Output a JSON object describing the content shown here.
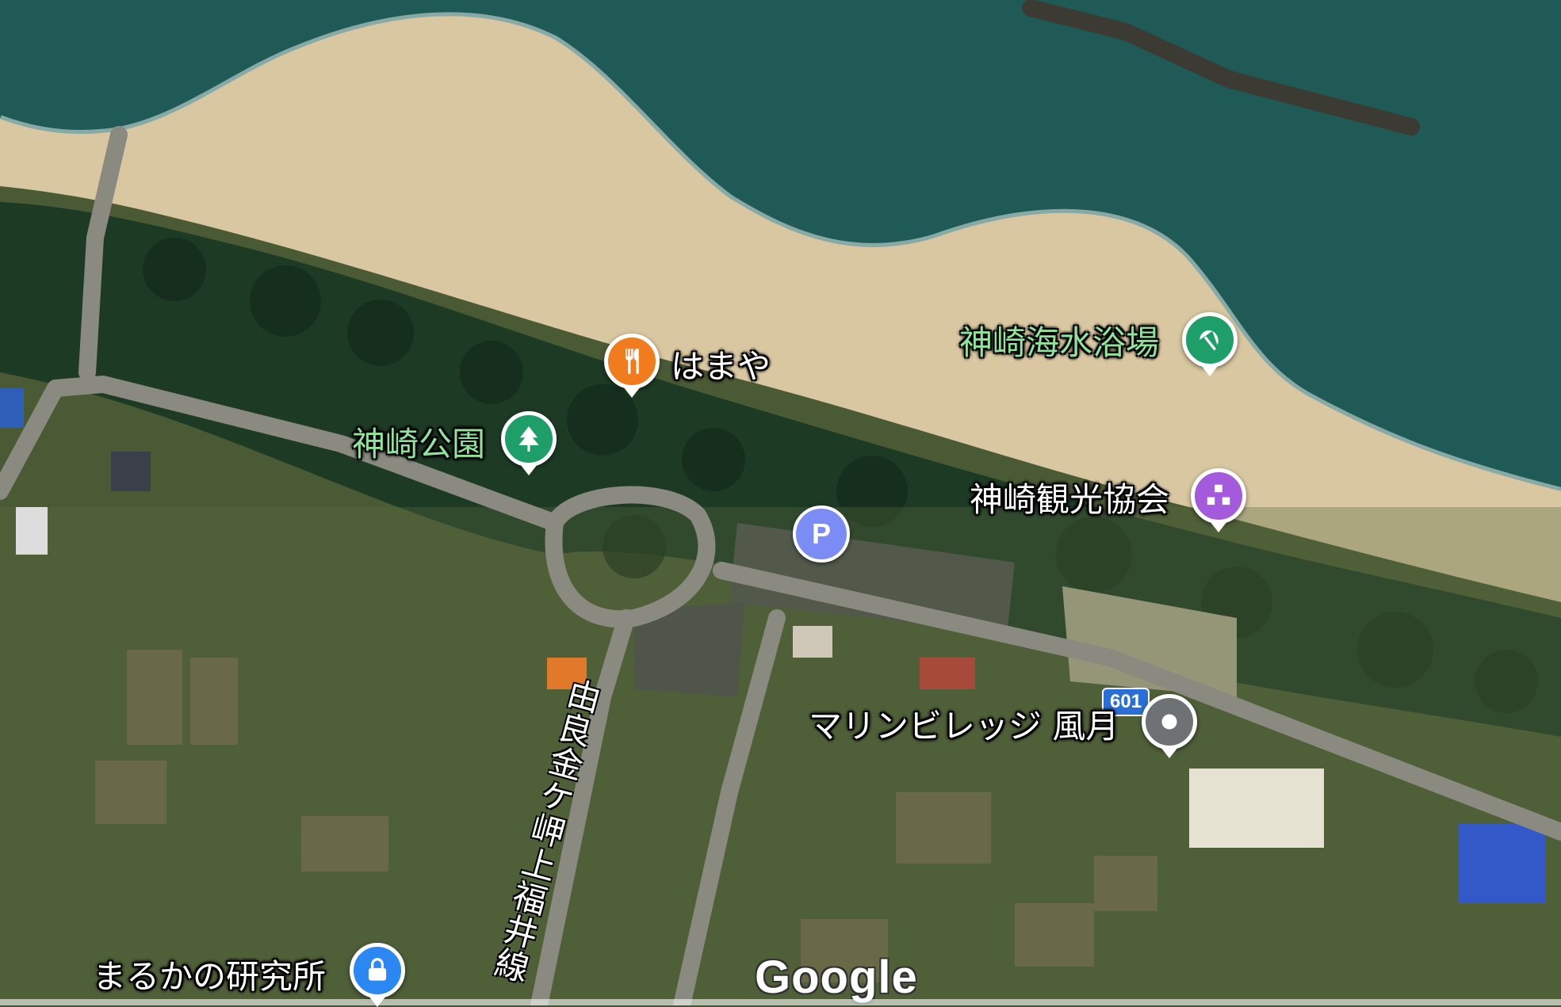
{
  "map": {
    "type": "satellite",
    "attribution_logo": "Google",
    "colors": {
      "sea": "#1f5a57",
      "sand": "#d8c7a0",
      "forest": "#1d3a25",
      "road": "#8a8a80",
      "fields": "#6f7a4c"
    }
  },
  "places": [
    {
      "id": "hamaya",
      "label": "はまや",
      "icon": "restaurant-icon",
      "color": "#f07c1e",
      "label_color": "white"
    },
    {
      "id": "kanzaki-beach",
      "label": "神崎海水浴場",
      "icon": "beach-umbrella-icon",
      "color": "#1e9e68",
      "label_color": "green"
    },
    {
      "id": "kanzaki-park",
      "label": "神崎公園",
      "icon": "tree-icon",
      "color": "#1e9e68",
      "label_color": "green"
    },
    {
      "id": "kanzaki-tourism",
      "label": "神崎観光協会",
      "icon": "building-icon",
      "color": "#a35bdc",
      "label_color": "white"
    },
    {
      "id": "marine-village",
      "label": "マリンビレッジ 風月",
      "icon": "pin-icon",
      "color": "#6e7275",
      "label_color": "white"
    },
    {
      "id": "marukano",
      "label": "まるかの研究所",
      "icon": "lock-icon",
      "color": "#2b87f2",
      "label_color": "white"
    }
  ],
  "parking": {
    "label": "P",
    "color": "#7c8cf5"
  },
  "road": {
    "name": "由良金ケ岬上福井線",
    "route_number": "601"
  }
}
